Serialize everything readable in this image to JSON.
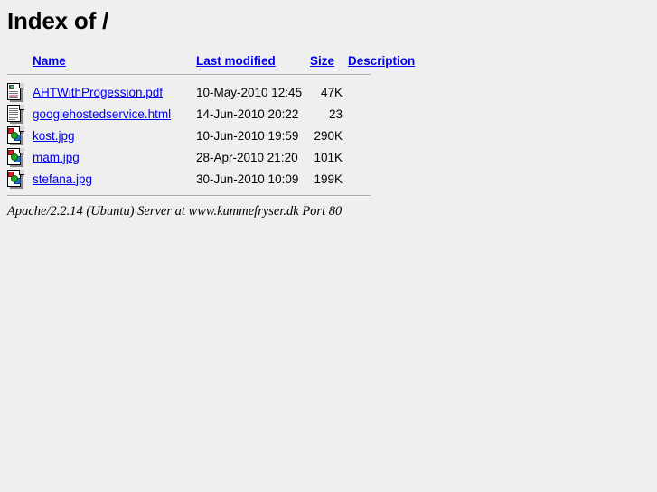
{
  "page": {
    "title": "Index of /",
    "background_color": "#efefef",
    "link_color": "#0000ee"
  },
  "table": {
    "headers": {
      "icon": "",
      "name": "Name",
      "last_modified": "Last modified",
      "size": "Size",
      "description": "Description"
    },
    "rows": [
      {
        "icon": "pdf-file-icon",
        "name": "AHTWithProgession.pdf",
        "last_modified": "10-May-2010 12:45",
        "size": "47K",
        "description": ""
      },
      {
        "icon": "html-file-icon",
        "name": "googlehostedservice.html",
        "last_modified": "14-Jun-2010 20:22",
        "size": "23",
        "description": ""
      },
      {
        "icon": "image-file-icon",
        "name": "kost.jpg",
        "last_modified": "10-Jun-2010 19:59",
        "size": "290K",
        "description": ""
      },
      {
        "icon": "image-file-icon",
        "name": "mam.jpg",
        "last_modified": "28-Apr-2010 21:20",
        "size": "101K",
        "description": ""
      },
      {
        "icon": "image-file-icon",
        "name": "stefana.jpg",
        "last_modified": "30-Jun-2010 10:09",
        "size": "199K",
        "description": ""
      }
    ]
  },
  "footer": {
    "server_signature": "Apache/2.2.14 (Ubuntu) Server at www.kummefryser.dk Port 80"
  }
}
